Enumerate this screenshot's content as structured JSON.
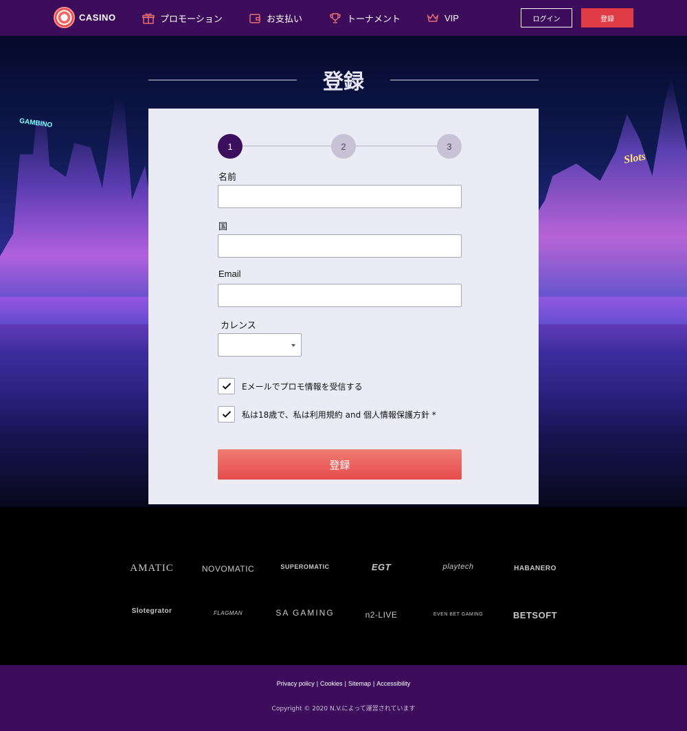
{
  "header": {
    "logo_text": "CASINO",
    "nav": [
      {
        "label": "プロモーション",
        "icon": "gift-icon"
      },
      {
        "label": "お支払い",
        "icon": "wallet-icon"
      },
      {
        "label": "トーナメント",
        "icon": "trophy-icon"
      },
      {
        "label": "VIP",
        "icon": "crown-icon"
      }
    ],
    "login_label": "ログイン",
    "register_label": "登録"
  },
  "hero": {
    "page_title": "登録",
    "sign_left": "GAMBINO",
    "sign_right": "Slots"
  },
  "form": {
    "steps": [
      "1",
      "2",
      "3"
    ],
    "active_step": 1,
    "name_label": "名前",
    "name_value": "",
    "country_label": "国",
    "country_value": "",
    "email_label": "Email",
    "email_value": "",
    "currency_label": "カレンス",
    "currency_value": "",
    "promo_checkbox_label": "Eメールでプロモ情報を受信する",
    "promo_checked": true,
    "terms_checkbox_label": "私は18歳で、私は利用規約 and 個人情報保護方針 *",
    "terms_checked": true,
    "submit_label": "登録"
  },
  "providers": [
    "AMATIC",
    "NOVOMATIC",
    "SUPEROMATIC",
    "EGT",
    "playtech",
    "HABANERO",
    "Slotegrator",
    "FLAGMAN",
    "SA GAMING",
    "n2-LIVE",
    "EVEN BET GAMING",
    "BETSOFT"
  ],
  "footer": {
    "links": [
      "Privacy policy",
      "Cookies",
      "Sitemap",
      "Accessibility"
    ],
    "copyright": "Copyright © 2020 N.V.によって運営されています"
  },
  "colors": {
    "header_bg": "#3d0d5c",
    "accent_red": "#e54b4b",
    "card_bg": "#ebebf5",
    "step_active": "#3b0f5e"
  }
}
